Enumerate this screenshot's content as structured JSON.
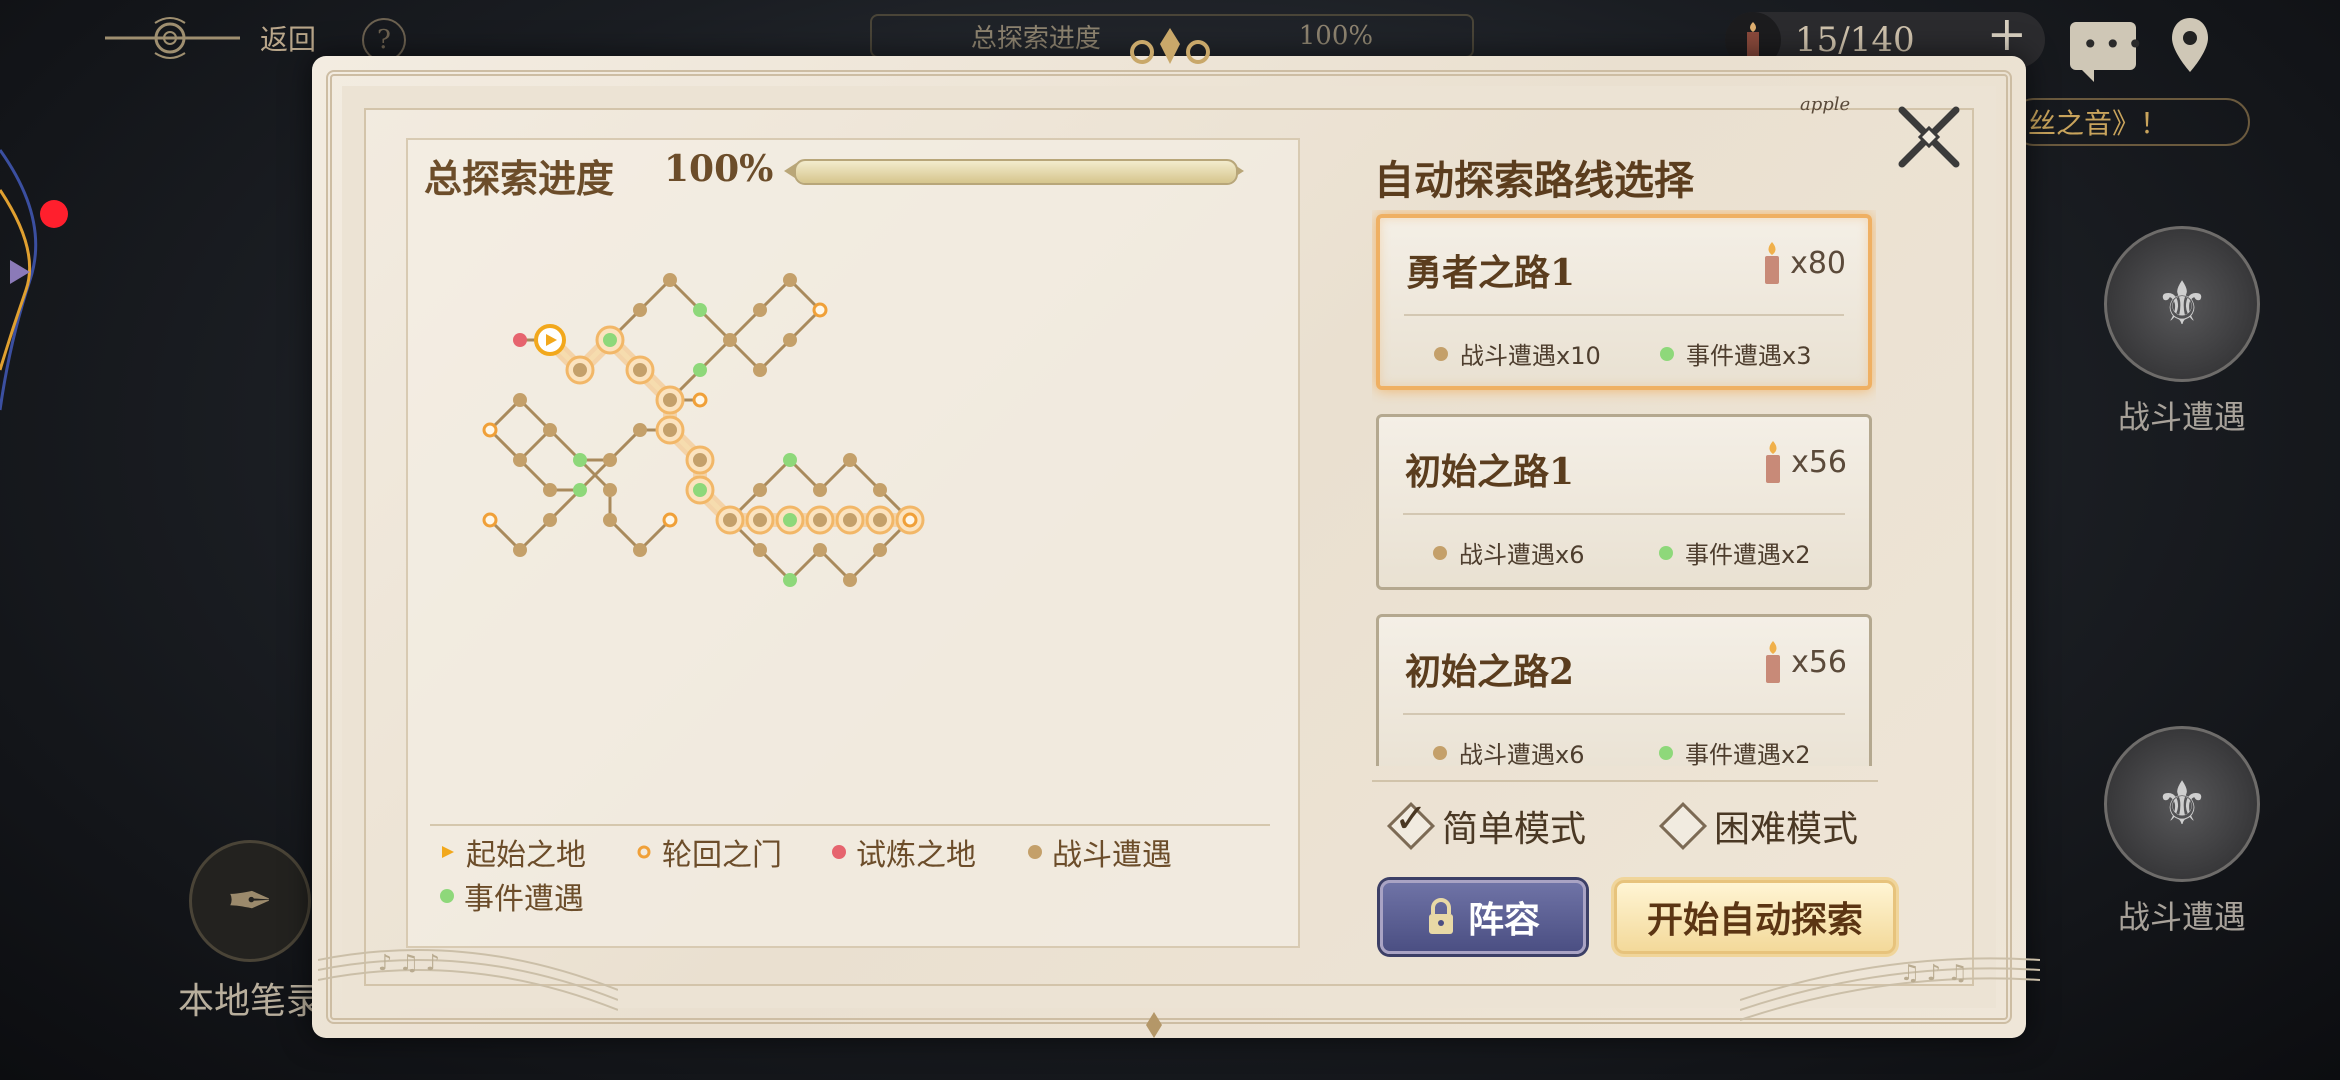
{
  "hud": {
    "back_label": "返回",
    "help_glyph": "?",
    "bg_progress_label": "总探索进度",
    "bg_progress_value": "100%",
    "candle_count": "15/140",
    "plus_glyph": "+",
    "notice_text": "丝之音》！",
    "side_encounter_top": "战斗遭遇",
    "side_encounter_bottom": "战斗遭遇",
    "notes_label": "本地笔录"
  },
  "modal": {
    "brand": "apple",
    "map": {
      "title": "总探索进度",
      "progress_text": "100%",
      "progress_fraction": 1.0
    },
    "legend": [
      {
        "label": "起始之地",
        "color": "#f2a81c"
      },
      {
        "label": "轮回之门",
        "color": "#f0a038"
      },
      {
        "label": "试炼之地",
        "color": "#e6646e"
      },
      {
        "label": "战斗遭遇",
        "color": "#c4a06a"
      },
      {
        "label": "事件遭遇",
        "color": "#8ed87a"
      }
    ],
    "routes_title": "自动探索路线选择",
    "routes": [
      {
        "name": "勇者之路1",
        "cost": "x80",
        "battle": "战斗遭遇x10",
        "event": "事件遭遇x3",
        "selected": true
      },
      {
        "name": "初始之路1",
        "cost": "x56",
        "battle": "战斗遭遇x6",
        "event": "事件遭遇x2",
        "selected": false
      },
      {
        "name": "初始之路2",
        "cost": "x56",
        "battle": "战斗遭遇x6",
        "event": "事件遭遇x2",
        "selected": false
      }
    ],
    "modes": [
      {
        "label": "简单模式",
        "checked": true
      },
      {
        "label": "困难模式",
        "checked": false
      }
    ],
    "lineup_label": "阵容",
    "start_label": "开始自动探索"
  },
  "colors": {
    "battle": "#c4a06a",
    "event": "#8ed87a",
    "trial": "#e6646e",
    "path_glow": "#f5c07a"
  }
}
